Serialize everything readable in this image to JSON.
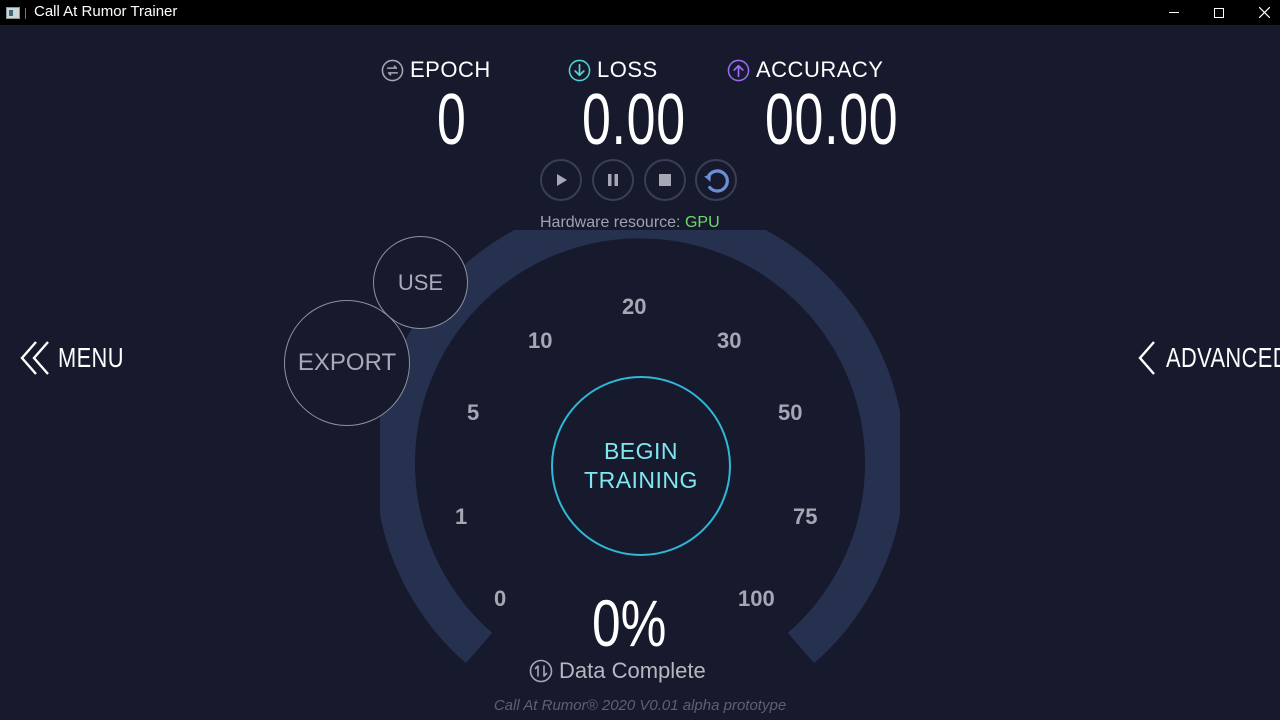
{
  "window": {
    "title": "Call At Rumor Trainer"
  },
  "stats": {
    "epoch": {
      "label": "EPOCH",
      "value": "0"
    },
    "loss": {
      "label": "LOSS",
      "value": "0.00"
    },
    "accuracy": {
      "label": "ACCURACY",
      "value": "00.00"
    }
  },
  "hardware": {
    "label": "Hardware resource:",
    "value": "GPU"
  },
  "nav": {
    "menu": "MENU",
    "advanced": "ADVANCED"
  },
  "actions": {
    "use": "USE",
    "export": "EXPORT",
    "begin_line1": "BEGIN",
    "begin_line2": "TRAINING"
  },
  "gauge": {
    "ticks": [
      "0",
      "1",
      "5",
      "10",
      "20",
      "30",
      "50",
      "75",
      "100"
    ],
    "percent_text": "0%",
    "percent_value": 0,
    "caption": "Data Complete"
  },
  "footer": "Call At Rumor® 2020 V0.01 alpha prototype",
  "colors": {
    "background": "#171a2c",
    "accent_cyan": "#2fb8d8",
    "gpu_green": "#6dda6d",
    "gauge_track": "#26314f",
    "loss_icon": "#4fd6d6",
    "accuracy_icon": "#9a6cf0"
  }
}
